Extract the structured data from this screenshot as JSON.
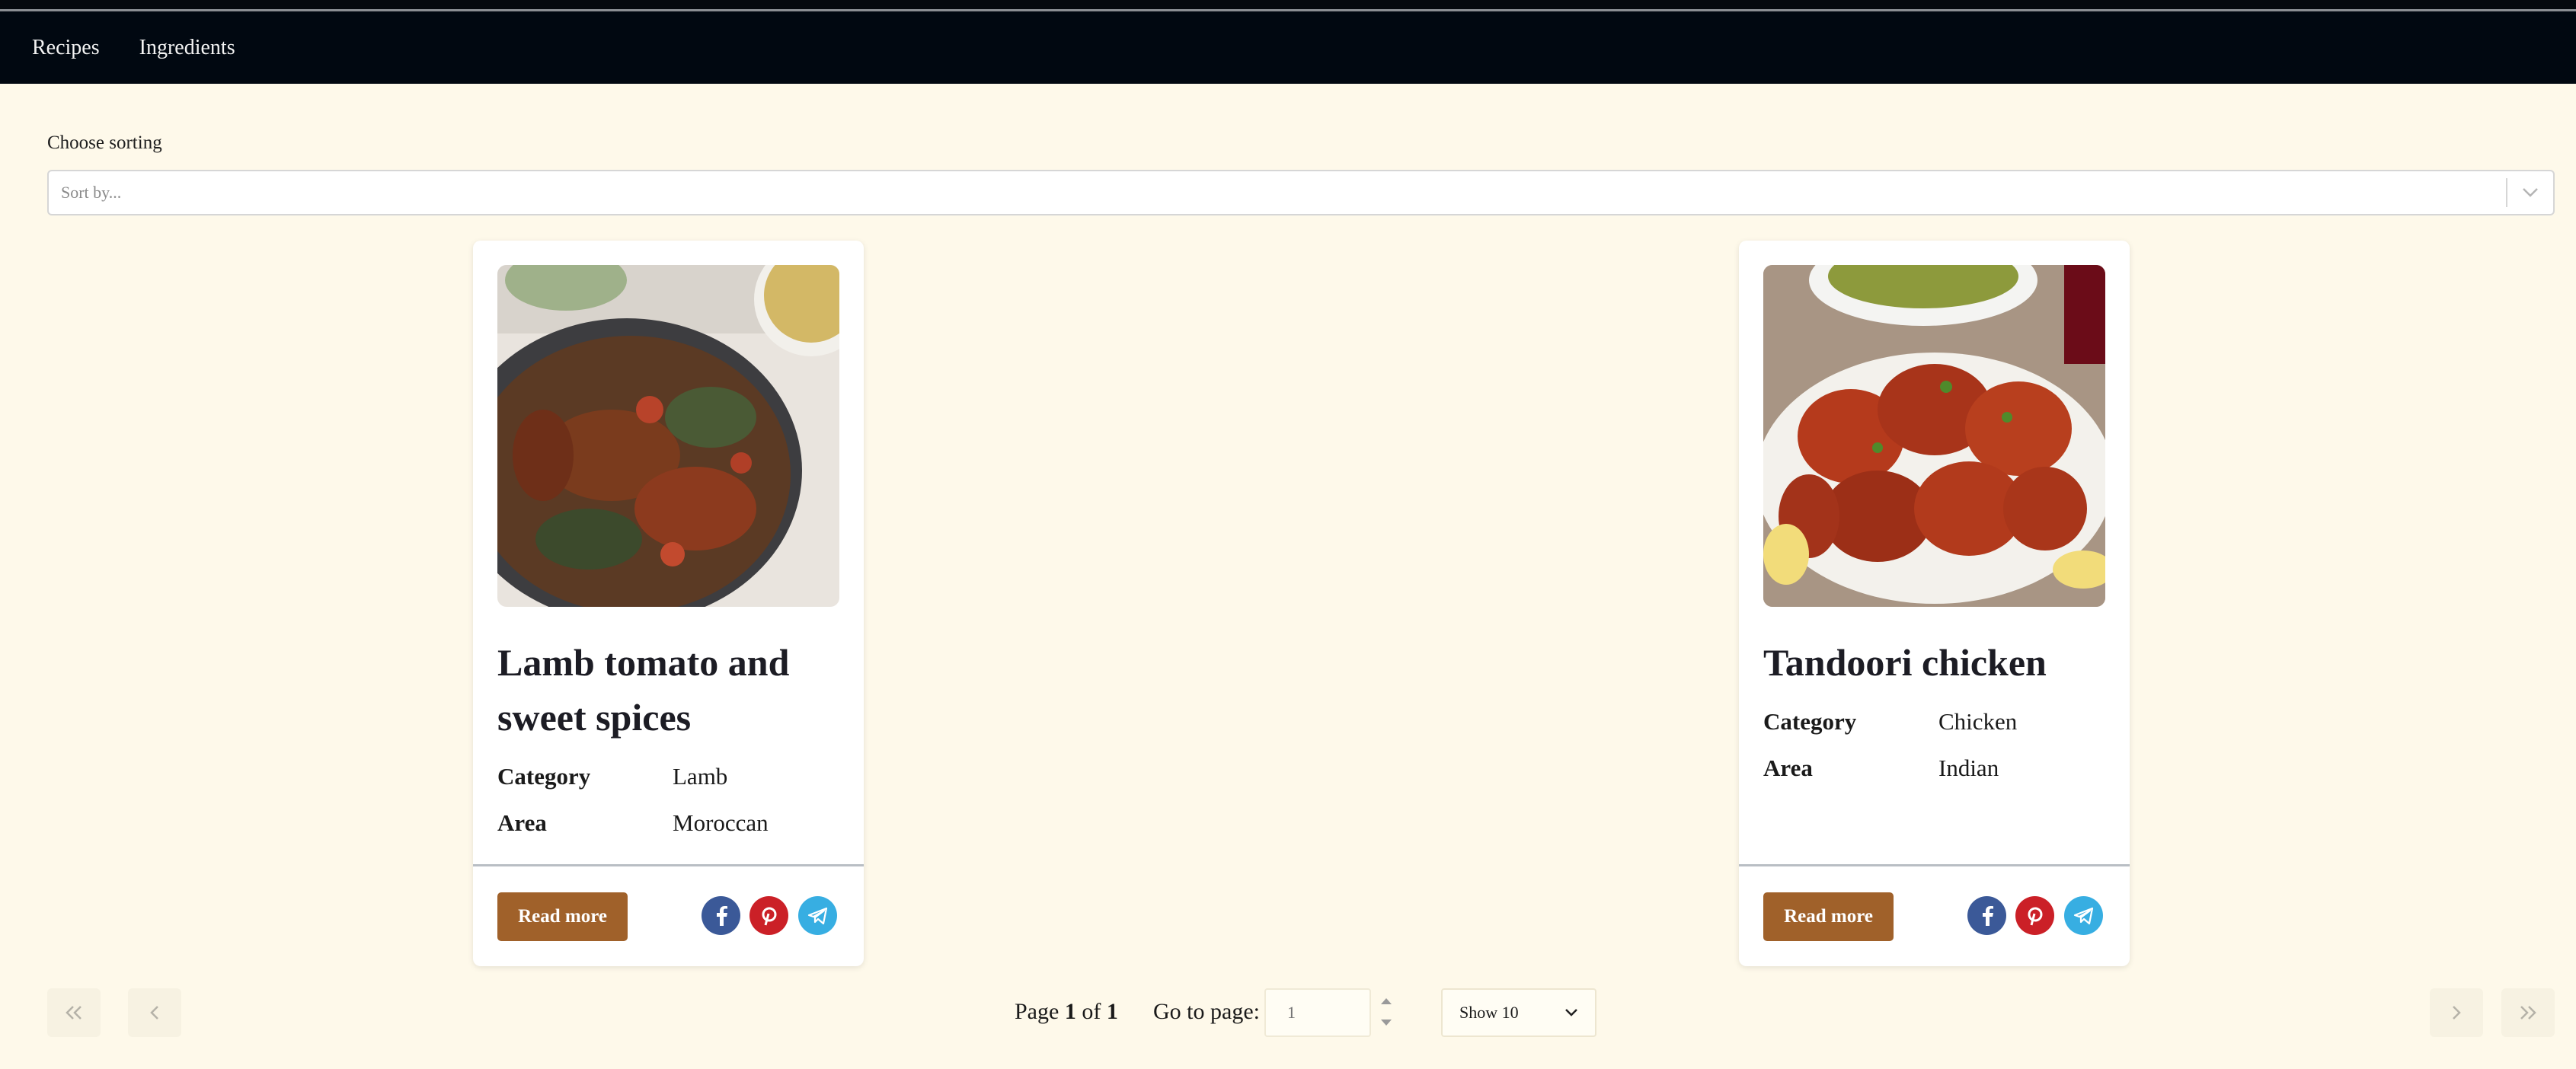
{
  "nav": {
    "items": [
      {
        "label": "Recipes"
      },
      {
        "label": "Ingredients"
      }
    ]
  },
  "sorting": {
    "label": "Choose sorting",
    "placeholder": "Sort by..."
  },
  "recipes": [
    {
      "title": "Lamb tomato and sweet spices",
      "category_label": "Category",
      "category": "Lamb",
      "area_label": "Area",
      "area": "Moroccan",
      "read_more": "Read more"
    },
    {
      "title": "Tandoori chicken",
      "category_label": "Category",
      "category": "Chicken",
      "area_label": "Area",
      "area": "Indian",
      "read_more": "Read more"
    }
  ],
  "share_icons": [
    "facebook-icon",
    "pinterest-icon",
    "telegram-icon"
  ],
  "pagination": {
    "page_prefix": "Page",
    "current": "1",
    "of": "of",
    "total": "1",
    "goto_label": "Go to page:",
    "goto_placeholder": "1",
    "page_size": "Show 10"
  },
  "colors": {
    "background": "#fef9ea",
    "navbar": "#010811",
    "read_more": "#a0612a",
    "facebook": "#3b5998",
    "pinterest": "#cb2027",
    "telegram": "#37aee2"
  }
}
